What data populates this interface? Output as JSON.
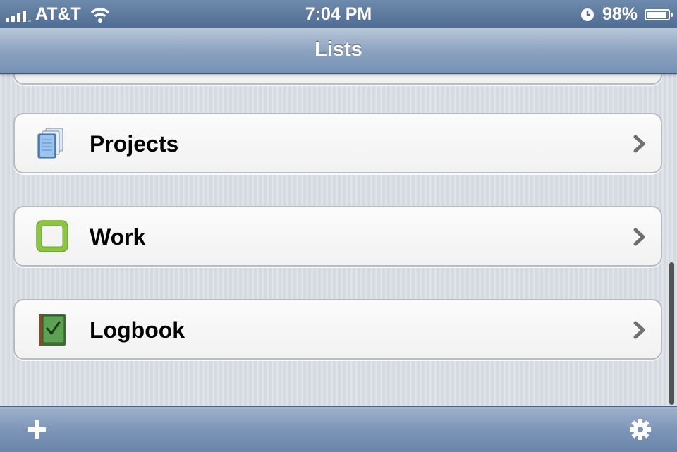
{
  "status_bar": {
    "carrier": "AT&T",
    "time": "7:04 PM",
    "battery_percent": "98%",
    "battery_level": 0.98,
    "signal_bars": 4,
    "icons": [
      "signal-icon",
      "wifi-icon",
      "alarm-clock-icon",
      "battery-icon"
    ]
  },
  "nav": {
    "title": "Lists"
  },
  "lists": [
    {
      "label": "Projects",
      "icon": "projects-icon"
    },
    {
      "label": "Work",
      "icon": "area-checkbox-icon"
    },
    {
      "label": "Logbook",
      "icon": "logbook-icon"
    }
  ],
  "toolbar": {
    "add_icon": "plus-icon",
    "settings_icon": "gear-icon"
  },
  "colors": {
    "nav_bar": "#8ca3c0",
    "toolbar": "#7b93b6",
    "background": "#d8dce4",
    "row_bg": "#f6f6f6",
    "work_icon_green": "#8cc63f",
    "logbook_green": "#4e9a45"
  }
}
